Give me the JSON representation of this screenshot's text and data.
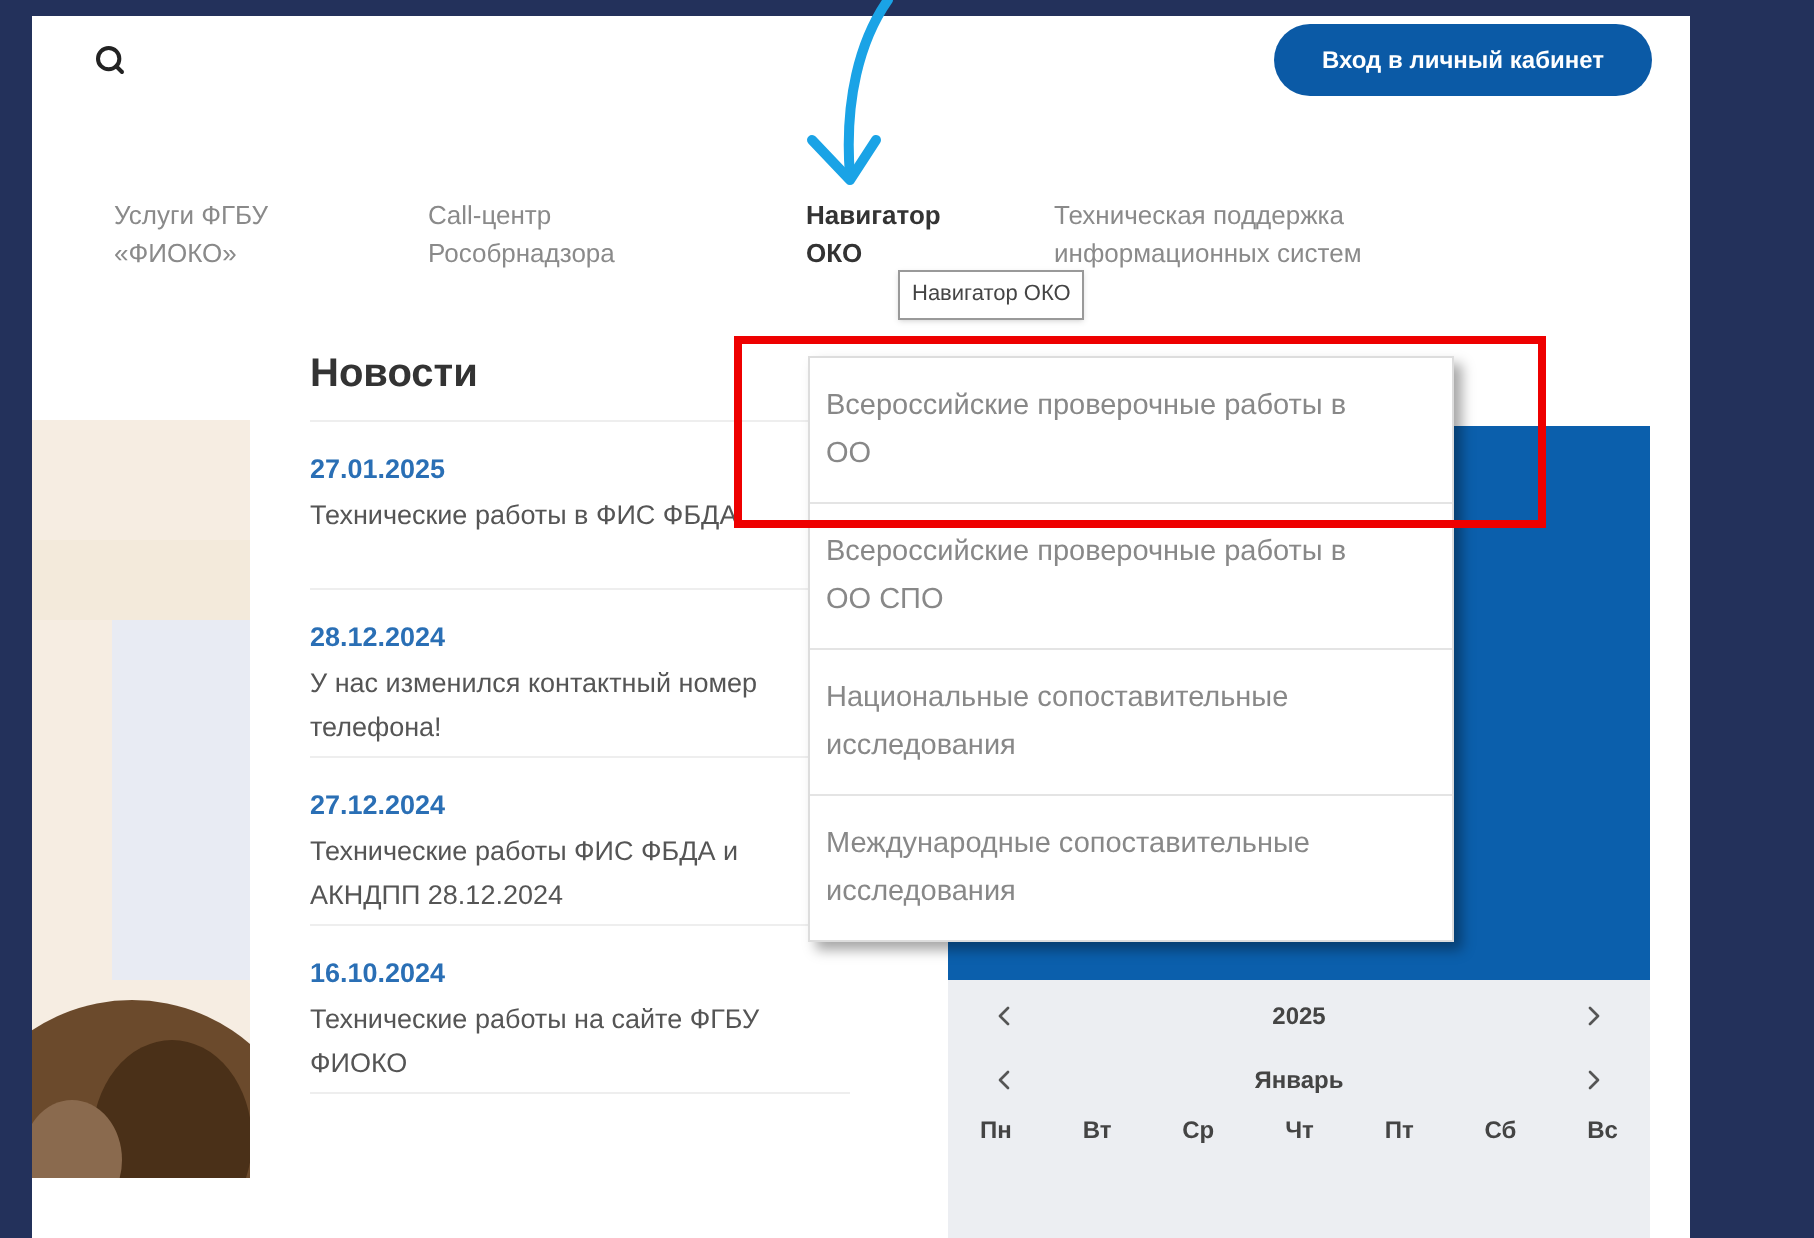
{
  "header": {
    "login_button": "Вход в личный кабинет"
  },
  "nav": [
    {
      "label": "Услуги ФГБУ «ФИОКО»",
      "selected": false
    },
    {
      "label": "Call-центр Рособрнадзора",
      "selected": false
    },
    {
      "label": "Навигатор ОКО",
      "selected": true
    },
    {
      "label": "Техническая поддержка информационных систем",
      "selected": false
    }
  ],
  "tooltip": "Навигатор ОКО",
  "dropdown": [
    "Всероссийские проверочные работы в ОО",
    "Всероссийские проверочные работы в ОО СПО",
    "Национальные сопоставительные исследования",
    "Международные сопоставительные исследования"
  ],
  "news": {
    "title": "Новости",
    "items": [
      {
        "date": "27.01.2025",
        "title": "Технические работы в ФИС ФБДА"
      },
      {
        "date": "28.12.2024",
        "title": "У нас изменился контактный номер телефона!"
      },
      {
        "date": "27.12.2024",
        "title": "Технические работы ФИС ФБДА и АКНДПП 28.12.2024"
      },
      {
        "date": "16.10.2024",
        "title": "Технические работы на сайте ФГБУ ФИОКО"
      }
    ]
  },
  "calendar": {
    "year": "2025",
    "month": "Январь",
    "weekdays": [
      "Пн",
      "Вт",
      "Ср",
      "Чт",
      "Пт",
      "Сб",
      "Вс"
    ]
  }
}
